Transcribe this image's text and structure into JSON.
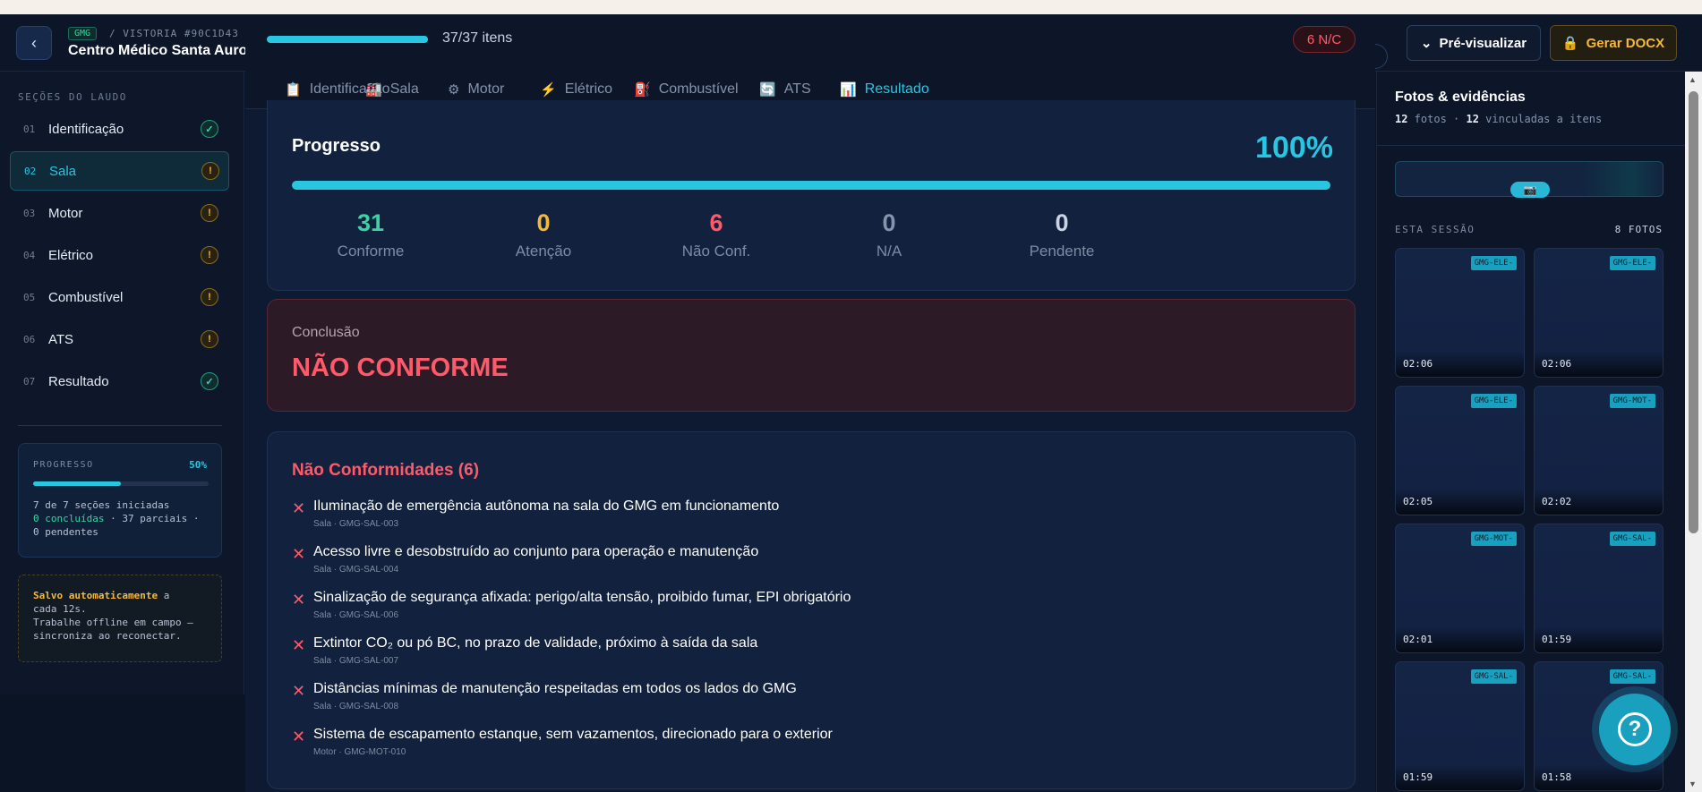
{
  "header": {
    "tag": "GMG",
    "vistoria": "/ VISTORIA #90C1D43",
    "site_name": "Centro Médico Santa Aurora",
    "preview_label": "Pré-visualizar",
    "docx_label": "Gerar DOCX"
  },
  "sidebar": {
    "title": "SEÇÕES DO LAUDO",
    "items": [
      {
        "num": "01",
        "label": "Identificação",
        "status": "ok"
      },
      {
        "num": "02",
        "label": "Sala",
        "status": "warn"
      },
      {
        "num": "03",
        "label": "Motor",
        "status": "warn"
      },
      {
        "num": "04",
        "label": "Elétrico",
        "status": "warn"
      },
      {
        "num": "05",
        "label": "Combustível",
        "status": "warn"
      },
      {
        "num": "06",
        "label": "ATS",
        "status": "warn"
      },
      {
        "num": "07",
        "label": "Resultado",
        "status": "ok"
      }
    ],
    "progress": {
      "title": "PROGRESSO",
      "pct": "50%",
      "fraction": 0.5,
      "line1": "7 de 7 seções iniciadas",
      "line2_a": "0 concluídas",
      "line2_b": " · 37 parciais ·",
      "line3": "0 pendentes"
    },
    "save": {
      "strong": "Salvo automaticamente",
      "line1_rest": " a",
      "line2": "cada 12s.",
      "line3": "Trabalhe offline em campo —",
      "line4": "sincroniza ao reconectar."
    }
  },
  "panel": {
    "items_text": "37/37 itens",
    "items_fraction": 1.0,
    "nc_badge": "6 N/C",
    "tabs": [
      {
        "label": "Identificação",
        "icon": "📋"
      },
      {
        "label": "Sala",
        "icon": "🏭"
      },
      {
        "label": "Motor",
        "icon": "⚙"
      },
      {
        "label": "Elétrico",
        "icon": "⚡"
      },
      {
        "label": "Combustível",
        "icon": "⛽"
      },
      {
        "label": "ATS",
        "icon": "🔄"
      },
      {
        "label": "Resultado",
        "icon": "📊"
      }
    ],
    "progress": {
      "title": "Progresso",
      "pct": "100%",
      "fraction": 1.0,
      "stats": [
        {
          "value": "31",
          "label": "Conforme",
          "color": "#39d3a4"
        },
        {
          "value": "0",
          "label": "Atenção",
          "color": "#f5b93a"
        },
        {
          "value": "6",
          "label": "Não Conf.",
          "color": "#ff5a6a"
        },
        {
          "value": "0",
          "label": "N/A",
          "color": "#8593ad"
        },
        {
          "value": "0",
          "label": "Pendente",
          "color": "#c9d3e6"
        }
      ]
    },
    "conclusion": {
      "label": "Conclusão",
      "value": "NÃO CONFORME"
    },
    "nonconformities": {
      "title": "Não Conformidades (6)",
      "items": [
        {
          "text": "Iluminação de emergência autônoma na sala do GMG em funcionamento",
          "sub": "Sala · GMG-SAL-003"
        },
        {
          "text": "Acesso livre e desobstruído ao conjunto para operação e manutenção",
          "sub": "Sala · GMG-SAL-004"
        },
        {
          "text": "Sinalização de segurança afixada: perigo/alta tensão, proibido fumar, EPI obrigatório",
          "sub": "Sala · GMG-SAL-006"
        },
        {
          "text": "Extintor CO₂ ou pó BC, no prazo de validade, próximo à saída da sala",
          "sub": "Sala · GMG-SAL-007"
        },
        {
          "text": "Distâncias mínimas de manutenção respeitadas em todos os lados do GMG",
          "sub": "Sala · GMG-SAL-008"
        },
        {
          "text": "Sistema de escapamento estanque, sem vazamentos, direcionado para o exterior",
          "sub": "Motor · GMG-MOT-010"
        }
      ]
    }
  },
  "photos": {
    "title": "Fotos & evidências",
    "count_a": "12",
    "count_a_label": " fotos · ",
    "count_b": "12",
    "count_b_label": " vinculadas a itens",
    "session_label": "ESTA SESSÃO",
    "session_count": "8 FOTOS",
    "thumbs": [
      {
        "tag": "GMG-ELE-",
        "time": "02:06"
      },
      {
        "tag": "GMG-ELE-",
        "time": "02:06"
      },
      {
        "tag": "GMG-ELE-",
        "time": "02:05"
      },
      {
        "tag": "GMG-MOT-",
        "time": "02:02"
      },
      {
        "tag": "GMG-MOT-",
        "time": "02:01"
      },
      {
        "tag": "GMG-SAL-",
        "time": "01:59"
      },
      {
        "tag": "GMG-SAL-",
        "time": "01:59"
      },
      {
        "tag": "GMG-SAL-",
        "time": "01:58"
      }
    ]
  },
  "help": {
    "label": "?"
  }
}
